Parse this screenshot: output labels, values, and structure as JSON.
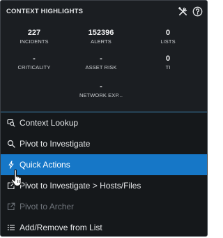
{
  "header": {
    "title": "CONTEXT HIGHLIGHTS",
    "icons": [
      "tools-icon",
      "help-icon"
    ]
  },
  "metrics": [
    {
      "value": "227",
      "label": "INCIDENTS"
    },
    {
      "value": "152396",
      "label": "ALERTS"
    },
    {
      "value": "0",
      "label": "LISTS"
    },
    {
      "value": "-",
      "label": "CRITICALITY"
    },
    {
      "value": "-",
      "label": "ASSET RISK"
    },
    {
      "value": "0",
      "label": "TI"
    },
    {
      "value": "-",
      "label": "NETWORK EXP..."
    }
  ],
  "menu": {
    "items": [
      {
        "label": "Context Lookup",
        "icon": "context-lookup-icon",
        "state": "normal"
      },
      {
        "label": "Pivot to Investigate",
        "icon": "search-icon",
        "state": "normal"
      },
      {
        "label": "Quick Actions",
        "icon": "lightning-icon",
        "state": "active"
      },
      {
        "label": "Pivot to Investigate > Hosts/Files",
        "icon": "external-link-icon",
        "state": "normal"
      },
      {
        "label": "Pivot to Archer",
        "icon": "external-link-icon",
        "state": "disabled"
      },
      {
        "label": "Add/Remove from List",
        "icon": "list-icon",
        "state": "normal"
      }
    ]
  },
  "colors": {
    "panel_bg": "#15181b",
    "highlight_bg": "#1b1e22",
    "accent": "#1677c7",
    "divider": "#3f88b8",
    "text": "#e6e8ea",
    "disabled_text": "#6e737a"
  }
}
